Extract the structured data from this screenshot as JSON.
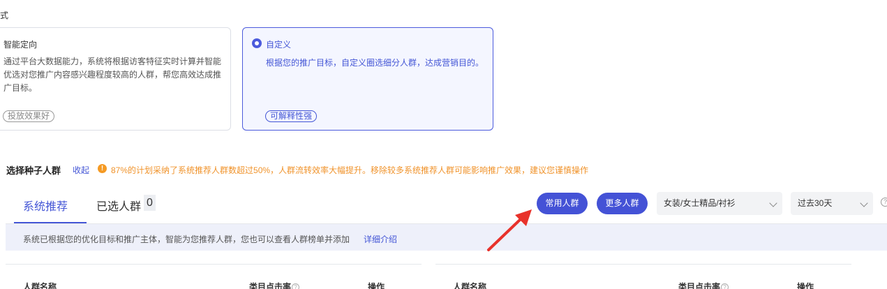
{
  "section_label": "方式",
  "mode_cards": {
    "smart": {
      "title": "智能定向",
      "description": "通过平台大数据能力，系统将根据访客特征实时计算并智能优选对您推广内容感兴趣程度较高的人群，帮您高效达成推广目标。",
      "tag": "投放效果好"
    },
    "custom": {
      "title": "自定义",
      "description": "根据您的推广目标，自定义圈选细分人群，达成营销目的。",
      "tag": "可解释性强",
      "selected": true
    }
  },
  "seed": {
    "title": "选择种子人群",
    "collapse_label": "收起",
    "warning_icon": "!",
    "warning_text": "87%的计划采纳了系统推荐人群数超过50%，人群流转效率大幅提升。移除较多系统推荐人群可能影响推广效果，建议您谨慎操作"
  },
  "tabs": {
    "system": "系统推荐",
    "selected": "已选人群",
    "selected_count": "0"
  },
  "buttons": {
    "common": "常用人群",
    "more": "更多人群"
  },
  "filters": {
    "category": "女装/女士精品/衬衫",
    "period": "过去30天"
  },
  "info": {
    "text": "系统已根据您的优化目标和推广主体，智能为您推荐人群，您也可以查看人群榜单并添加",
    "link": "详细介绍"
  },
  "table": {
    "col_name": "人群名称",
    "col_ctr": "类目点击率",
    "col_action": "操作",
    "help_glyph": "?"
  },
  "colors": {
    "accent": "#4456d6",
    "warning": "#f0932b",
    "info_bg": "#eef0fa",
    "annotation_arrow": "#e8322b"
  }
}
